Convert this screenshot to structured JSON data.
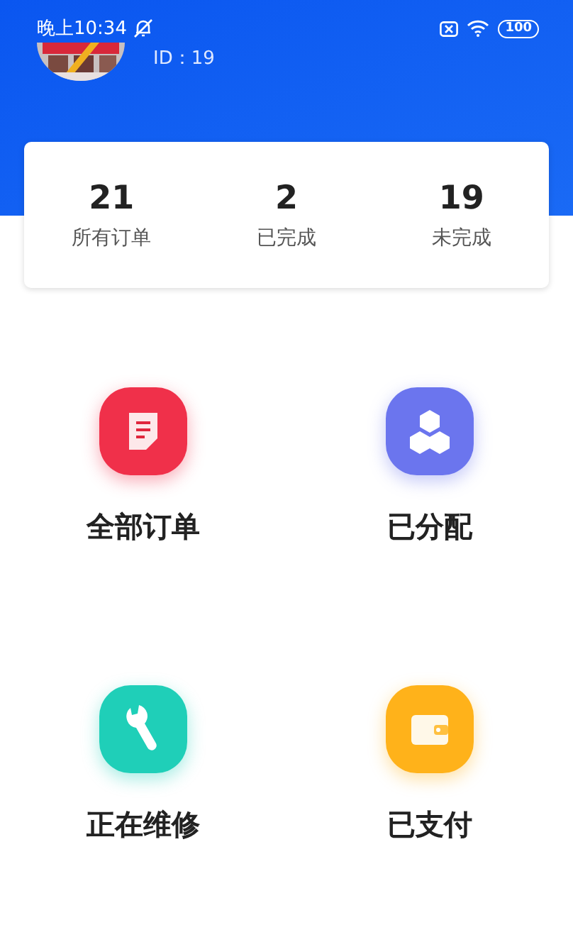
{
  "status_bar": {
    "time": "晚上10:34",
    "battery": "100"
  },
  "profile": {
    "id_label": "ID：19"
  },
  "stats": [
    {
      "value": "21",
      "label": "所有订单"
    },
    {
      "value": "2",
      "label": "已完成"
    },
    {
      "value": "19",
      "label": "未完成"
    }
  ],
  "menu": [
    {
      "kind": "document",
      "label": "全部订单",
      "color": "#f0304a"
    },
    {
      "kind": "cubes",
      "label": "已分配",
      "color": "#6b75ee"
    },
    {
      "kind": "wrench",
      "label": "正在维修",
      "color": "#1fcfb8"
    },
    {
      "kind": "wallet",
      "label": "已支付",
      "color": "#ffb21a"
    }
  ]
}
